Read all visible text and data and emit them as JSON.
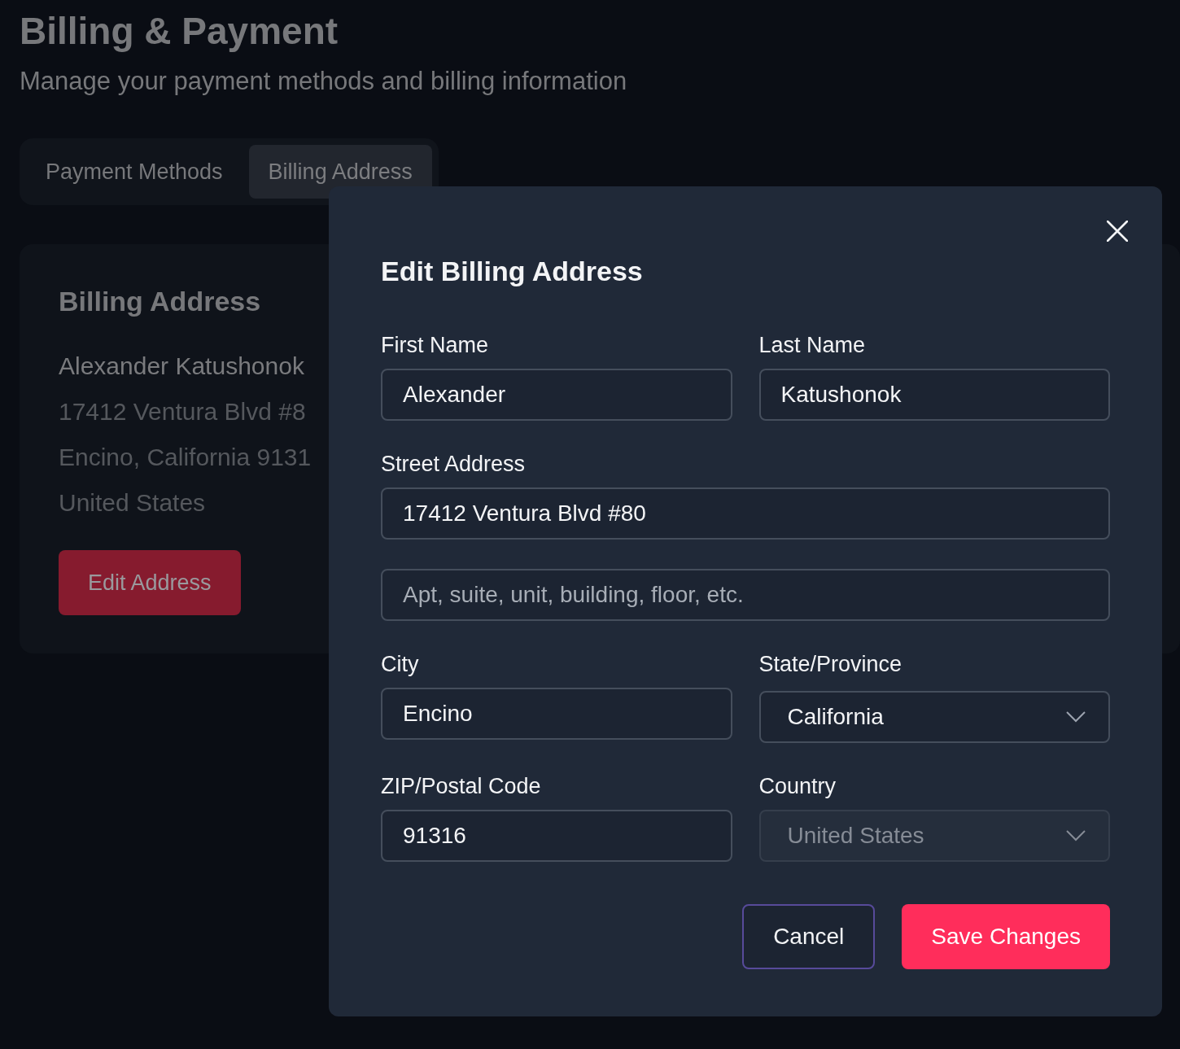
{
  "page": {
    "title": "Billing & Payment",
    "subtitle": "Manage your payment methods and billing information"
  },
  "tabs": [
    {
      "label": "Payment Methods",
      "selected": false
    },
    {
      "label": "Billing Address",
      "selected": true
    }
  ],
  "card": {
    "heading": "Billing Address",
    "lines": [
      "Alexander Katushonok",
      "17412 Ventura Blvd #8",
      "Encino, California 9131",
      "United States"
    ],
    "button": "Edit Address"
  },
  "dialog": {
    "title": "Edit Billing Address",
    "rows": [
      [
        {
          "kind": "input",
          "label": "First Name",
          "value": "Alexander"
        },
        {
          "kind": "input",
          "label": "Last Name",
          "value": "Katushonok"
        }
      ],
      [
        {
          "kind": "input",
          "label": "Street Address",
          "value": "17412 Ventura Blvd #80"
        }
      ],
      [
        {
          "kind": "input",
          "placeholder": "Apt, suite, unit, building, floor, etc."
        }
      ],
      [
        {
          "kind": "input",
          "label": "City",
          "value": "Encino"
        },
        {
          "kind": "select",
          "label": "State/Province",
          "value": "California",
          "disabled": false
        }
      ],
      [
        {
          "kind": "input",
          "label": "ZIP/Postal Code",
          "value": "91316"
        },
        {
          "kind": "select",
          "label": "Country",
          "value": "United States",
          "disabled": true
        }
      ]
    ],
    "buttons": [
      {
        "kind": "secondary",
        "label": "Cancel"
      },
      {
        "kind": "primary",
        "label": "Save Changes"
      }
    ]
  }
}
